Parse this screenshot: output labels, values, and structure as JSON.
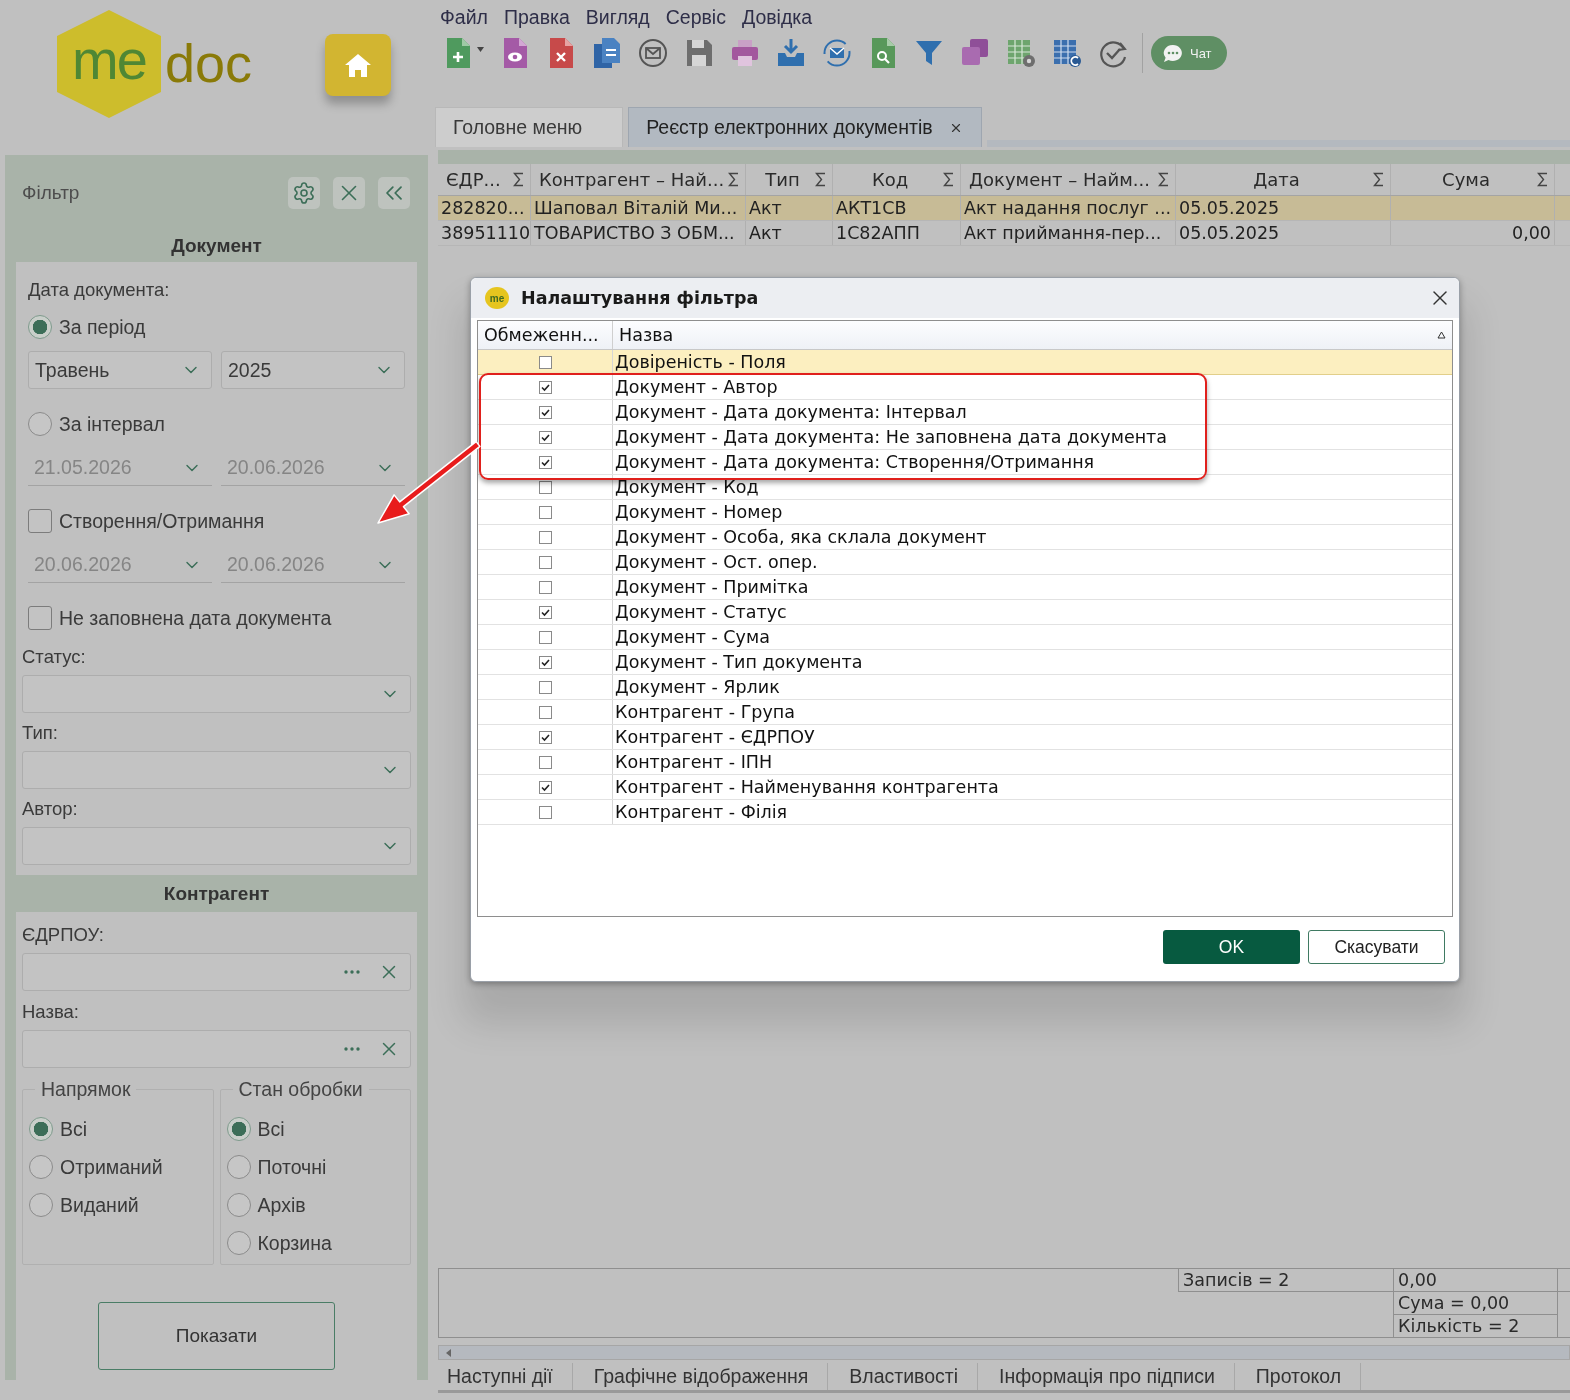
{
  "logo": {
    "mark": "me",
    "wordmark": "doc"
  },
  "menu": [
    "Файл",
    "Правка",
    "Вигляд",
    "Сервіс",
    "Довідка"
  ],
  "toolbar": {
    "chat_label": "Чат"
  },
  "tabs": [
    {
      "label": "Головне меню",
      "selected": false,
      "closable": false
    },
    {
      "label": "Реєстр електронних документів",
      "selected": true,
      "closable": true
    }
  ],
  "filter_panel": {
    "title": "Фільтр",
    "document_section": {
      "title": "Документ",
      "blocks": [
        {
          "kind": "caption",
          "label": "Дата документа:"
        },
        {
          "kind": "radio",
          "label": "За період",
          "selected": true
        },
        {
          "kind": "selects",
          "values": [
            "Травень",
            "2025"
          ]
        },
        {
          "kind": "radio",
          "label": "За інтервал",
          "selected": false
        },
        {
          "kind": "dates",
          "disabled": true,
          "values": [
            "21.05.2026",
            "20.06.2026"
          ]
        },
        {
          "kind": "checkbox",
          "label": "Створення/Отримання",
          "checked": false
        },
        {
          "kind": "dates",
          "disabled": true,
          "values": [
            "20.06.2026",
            "20.06.2026"
          ]
        },
        {
          "kind": "checkbox",
          "label": "Не заповнена дата документа",
          "checked": false
        },
        {
          "kind": "dropdown",
          "label": "Статус:"
        },
        {
          "kind": "dropdown",
          "label": "Тип:"
        },
        {
          "kind": "dropdown",
          "label": "Автор:"
        }
      ]
    },
    "counterparty_section": {
      "title": "Контрагент",
      "fields": [
        {
          "label": "ЄДРПОУ:"
        },
        {
          "label": "Назва:"
        }
      ],
      "groups": [
        {
          "title": "Напрямок",
          "options": [
            {
              "label": "Всі",
              "selected": true
            },
            {
              "label": "Отриманий",
              "selected": false
            },
            {
              "label": "Виданий",
              "selected": false
            }
          ]
        },
        {
          "title": "Стан обробки",
          "options": [
            {
              "label": "Всі",
              "selected": true
            },
            {
              "label": "Поточні",
              "selected": false
            },
            {
              "label": "Архів",
              "selected": false
            },
            {
              "label": "Корзина",
              "selected": false
            }
          ]
        }
      ]
    },
    "show_button": "Показати"
  },
  "documents_table": {
    "columns": [
      "ЄДР...",
      "Контрагент – Най...",
      "Тип",
      "Код",
      "Документ – Найм...",
      "Дата",
      "Сума"
    ],
    "rows": [
      {
        "selected": true,
        "cells": [
          "282820...",
          "Шаповал Віталій Ми...",
          "Акт",
          "АКТ1СВ",
          "Акт надання послуг ...",
          "05.05.2025"
        ]
      },
      {
        "selected": false,
        "cells": [
          "38951110",
          "ТОВАРИСТВО З ОБМ...",
          "Акт",
          "1С82АПП",
          "Акт приймання-пер...",
          "05.05.2025",
          "0,00"
        ]
      }
    ]
  },
  "summary": {
    "records": "Записів = 2",
    "totals": [
      "0,00",
      "Сума = 0,00",
      "Кількість = 2"
    ]
  },
  "bottom_tabs": [
    "Наступні дії",
    "Графічне відображення",
    "Властивості",
    "Інформація про підписи",
    "Протокол"
  ],
  "dialog": {
    "icon_text": "me",
    "title": "Налаштування фільтра",
    "columns": [
      "Обмеженн...",
      "Назва"
    ],
    "rows": [
      {
        "name": "Довіреність - Поля",
        "checked": false,
        "selected": true,
        "highlighted": false
      },
      {
        "name": "Документ - Автор",
        "checked": true,
        "selected": false,
        "highlighted": true
      },
      {
        "name": "Документ - Дата документа: Інтервал",
        "checked": true,
        "selected": false,
        "highlighted": true
      },
      {
        "name": "Документ - Дата документа: Не заповнена дата документа",
        "checked": true,
        "selected": false,
        "highlighted": true
      },
      {
        "name": "Документ - Дата документа: Створення/Отримання",
        "checked": true,
        "selected": false,
        "highlighted": true
      },
      {
        "name": "Документ - Код",
        "checked": false,
        "selected": false,
        "highlighted": false
      },
      {
        "name": "Документ - Номер",
        "checked": false,
        "selected": false,
        "highlighted": false
      },
      {
        "name": "Документ - Особа, яка склала документ",
        "checked": false,
        "selected": false,
        "highlighted": false
      },
      {
        "name": "Документ - Ост. опер.",
        "checked": false,
        "selected": false,
        "highlighted": false
      },
      {
        "name": "Документ - Примітка",
        "checked": false,
        "selected": false,
        "highlighted": false
      },
      {
        "name": "Документ - Статус",
        "checked": true,
        "selected": false,
        "highlighted": false
      },
      {
        "name": "Документ - Сума",
        "checked": false,
        "selected": false,
        "highlighted": false
      },
      {
        "name": "Документ - Тип документа",
        "checked": true,
        "selected": false,
        "highlighted": false
      },
      {
        "name": "Документ - Ярлик",
        "checked": false,
        "selected": false,
        "highlighted": false
      },
      {
        "name": "Контрагент - Група",
        "checked": false,
        "selected": false,
        "highlighted": false
      },
      {
        "name": "Контрагент - ЄДРПОУ",
        "checked": true,
        "selected": false,
        "highlighted": false
      },
      {
        "name": "Контрагент - ІПН",
        "checked": false,
        "selected": false,
        "highlighted": false
      },
      {
        "name": "Контрагент - Найменування контрагента",
        "checked": true,
        "selected": false,
        "highlighted": false
      },
      {
        "name": "Контрагент - Філія",
        "checked": false,
        "selected": false,
        "highlighted": false
      }
    ],
    "buttons": [
      {
        "label": "OK",
        "kind": "primary"
      },
      {
        "label": "Скасувати",
        "kind": "secondary"
      }
    ]
  },
  "annotations": [
    {
      "kind": "arrow"
    }
  ]
}
